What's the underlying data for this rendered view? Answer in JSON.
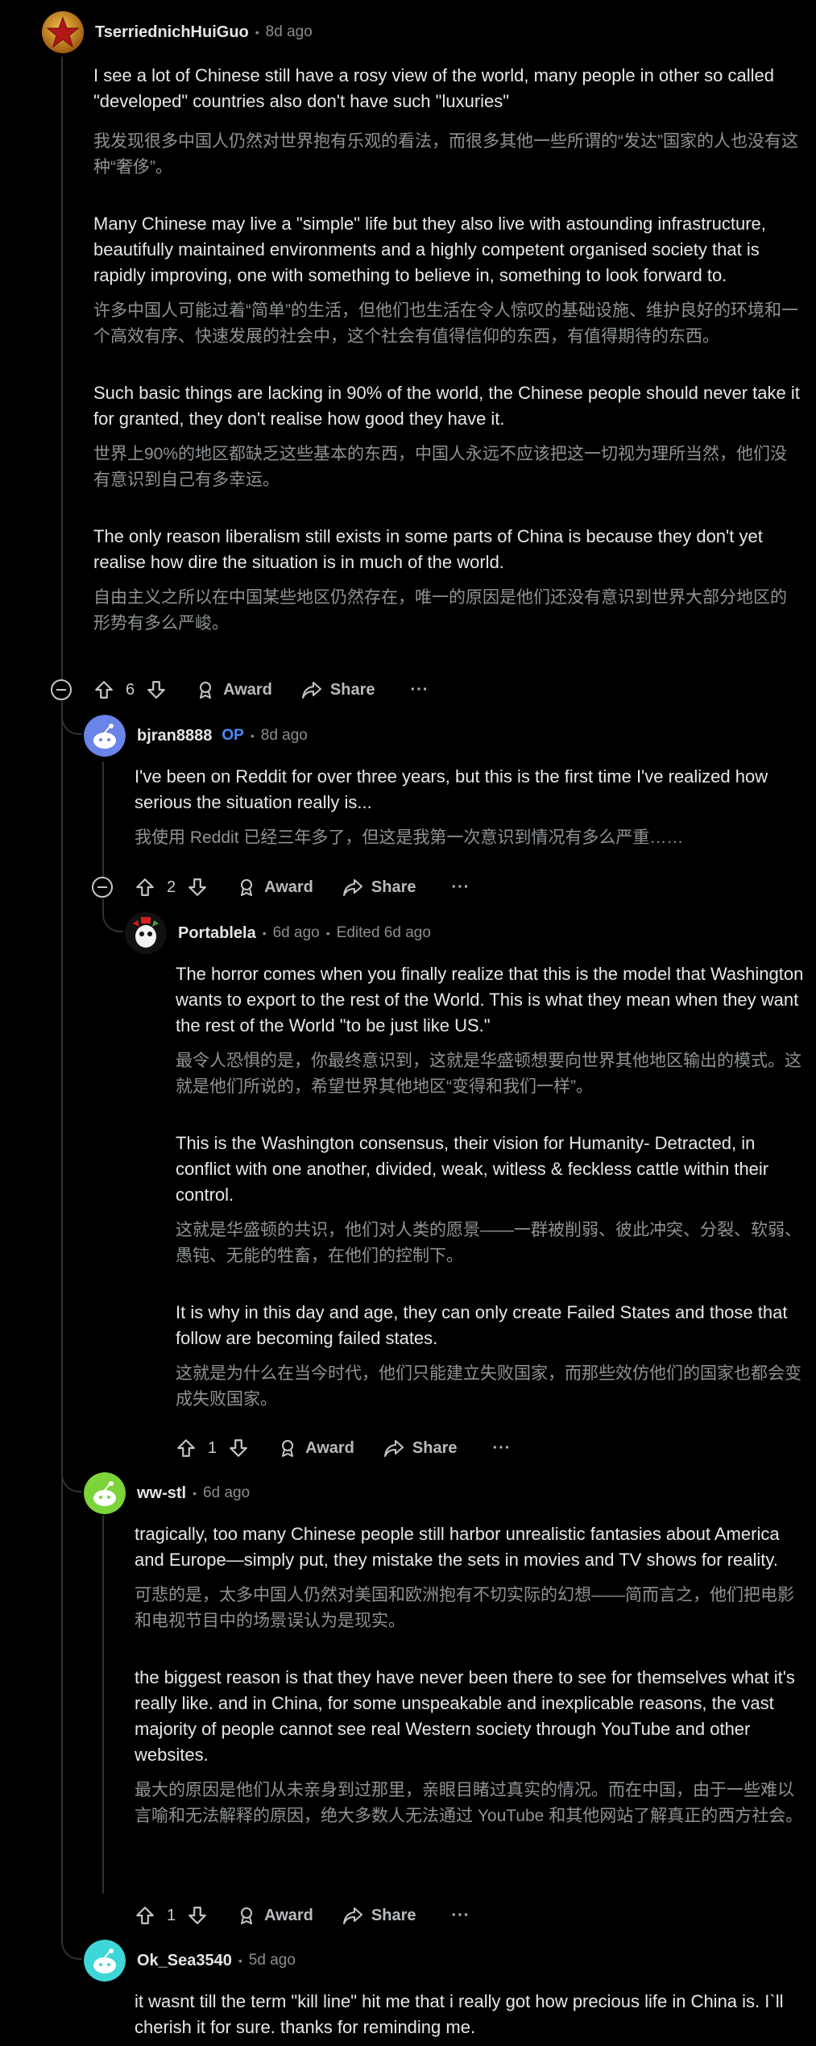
{
  "comments": [
    {
      "username": "TserriednichHuiGuo",
      "age": "8d ago",
      "paragraphs": [
        {
          "en": "I see a lot of Chinese still have a rosy view of the world, many people in other so called \"developed\" countries also don't have such \"luxuries\"",
          "zh": "我发现很多中国人仍然对世界抱有乐观的看法，而很多其他一些所谓的“发达”国家的人也没有这种“奢侈”。"
        },
        {
          "en": "Many Chinese may live a \"simple\" life but they also live with astounding infrastructure, beautifully maintained environments and a highly competent organised society that is rapidly improving, one with something to believe in, something to look forward to.",
          "zh": "许多中国人可能过着“简单”的生活，但他们也生活在令人惊叹的基础设施、维护良好的环境和一个高效有序、快速发展的社会中，这个社会有值得信仰的东西，有值得期待的东西。"
        },
        {
          "en": "Such basic things are lacking in 90% of the world, the Chinese people should never take it for granted, they don't realise how good they have it.",
          "zh": "世界上90%的地区都缺乏这些基本的东西，中国人永远不应该把这一切视为理所当然，他们没有意识到自己有多幸运。"
        },
        {
          "en": "The only reason liberalism still exists in some parts of China is because they don't yet realise how dire the situation is in much of the world.",
          "zh": "自由主义之所以在中国某些地区仍然存在，唯一的原因是他们还没有意识到世界大部分地区的形势有多么严峻。"
        }
      ],
      "votes": "6",
      "award": "Award",
      "share": "Share",
      "more": "···"
    },
    {
      "username": "bjran8888",
      "op": "OP",
      "age": "8d ago",
      "paragraphs": [
        {
          "en": "I've been on Reddit for over three years, but this is the first time I've realized how serious the situation really is...",
          "zh": "我使用 Reddit 已经三年多了，但这是我第一次意识到情况有多么严重……"
        }
      ],
      "votes": "2",
      "award": "Award",
      "share": "Share",
      "more": "···"
    },
    {
      "username": "Portablela",
      "age": "6d ago",
      "edited": "Edited 6d ago",
      "paragraphs": [
        {
          "en": "The horror comes when you finally realize that this is the model that Washington wants to export to the rest of the World. This is what they mean when they want the rest of the World \"to be just like US.\"",
          "zh": "最令人恐惧的是，你最终意识到，这就是华盛顿想要向世界其他地区输出的模式。这就是他们所说的，希望世界其他地区“变得和我们一样”。"
        },
        {
          "en": "This is the Washington consensus, their vision for Humanity- Detracted, in conflict with one another, divided, weak, witless & feckless cattle within their control.",
          "zh": "这就是华盛顿的共识，他们对人类的愿景——一群被削弱、彼此冲突、分裂、软弱、愚钝、无能的牲畜，在他们的控制下。"
        },
        {
          "en": "It is why in this day and age, they can only create Failed States and those that follow are becoming failed states.",
          "zh": "这就是为什么在当今时代，他们只能建立失败国家，而那些效仿他们的国家也都会变成失败国家。"
        }
      ],
      "votes": "1",
      "award": "Award",
      "share": "Share",
      "more": "···"
    },
    {
      "username": "ww-stl",
      "age": "6d ago",
      "paragraphs": [
        {
          "en": "tragically, too many Chinese people still harbor unrealistic fantasies about America and Europe—simply put, they mistake the sets in movies and TV shows for reality.",
          "zh": "可悲的是，太多中国人仍然对美国和欧洲抱有不切实际的幻想——简而言之，他们把电影和电视节目中的场景误认为是现实。"
        },
        {
          "en": "the biggest reason is that they have never been there to see for themselves what it's really like. and in China, for some unspeakable and inexplicable reasons, the vast majority of people cannot see real Western society through YouTube and other websites.",
          "zh": "最大的原因是他们从未亲身到过那里，亲眼目睹过真实的情况。而在中国，由于一些难以言喻和无法解释的原因，绝大多数人无法通过 YouTube 和其他网站了解真正的西方社会。"
        }
      ],
      "votes": "1",
      "award": "Award",
      "share": "Share",
      "more": "···"
    },
    {
      "username": "Ok_Sea3540",
      "age": "5d ago",
      "paragraphs": [
        {
          "en": "it wasnt till the term \"kill line\" hit me that i really got how precious life in China is. I`ll cherish it for sure. thanks for reminding me.",
          "zh": ""
        }
      ]
    }
  ],
  "colors": {
    "background": "#000000",
    "op_tag": "#4a8df8",
    "thread_line": "#2f3234"
  }
}
